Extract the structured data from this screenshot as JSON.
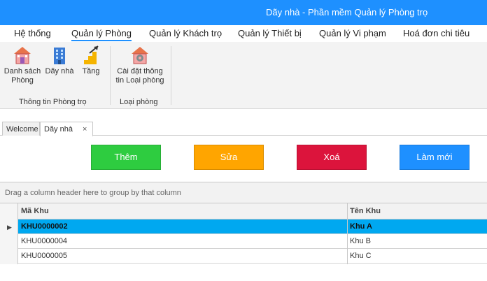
{
  "window": {
    "title": "Dãy nhà - Phần mềm Quản lý Phòng trọ"
  },
  "menu": {
    "tabs": [
      {
        "label": "Hệ thống"
      },
      {
        "label": "Quản lý Phòng"
      },
      {
        "label": "Quản lý Khách trọ"
      },
      {
        "label": "Quản lý Thiết bị"
      },
      {
        "label": "Quản lý Vi phạm"
      },
      {
        "label": "Hoá đơn chi tiêu"
      }
    ],
    "active": "Quản lý Phòng"
  },
  "ribbon": {
    "groups": [
      {
        "label": "Thông tin Phòng trọ",
        "buttons": [
          {
            "label": "Danh sách Phòng",
            "icon": "house-icon"
          },
          {
            "label": "Dãy nhà",
            "icon": "building-icon"
          },
          {
            "label": "Tầng",
            "icon": "stairs-icon"
          }
        ]
      },
      {
        "label": "Loại phòng",
        "buttons": [
          {
            "label": "Cài đặt thông tin Loại phòng",
            "icon": "house-settings-icon"
          }
        ]
      }
    ]
  },
  "doc_tabs": {
    "tabs": [
      {
        "label": "Welcome"
      },
      {
        "label": "Dãy nhà"
      }
    ],
    "active": "Dãy nhà",
    "close_glyph": "×"
  },
  "actions": {
    "add": {
      "label": "Thêm",
      "color": "#2ecc40"
    },
    "edit": {
      "label": "Sửa",
      "color": "#ffa500"
    },
    "delete": {
      "label": "Xoá",
      "color": "#dc143c"
    },
    "refresh": {
      "label": "Làm mới",
      "color": "#1e90ff"
    }
  },
  "grid": {
    "group_panel_text": "Drag a column header here to group by that column",
    "columns": [
      "Mã Khu",
      "Tên Khu"
    ],
    "rows": [
      {
        "ma_khu": "KHU0000002",
        "ten_khu": "Khu A",
        "selected": true
      },
      {
        "ma_khu": "KHU0000004",
        "ten_khu": "Khu B",
        "selected": false
      },
      {
        "ma_khu": "KHU0000005",
        "ten_khu": "Khu C",
        "selected": false
      }
    ],
    "focused_row_glyph": "▶",
    "selection_color": "#00a8f0"
  },
  "theme": {
    "titlebar_color": "#1e90ff"
  }
}
